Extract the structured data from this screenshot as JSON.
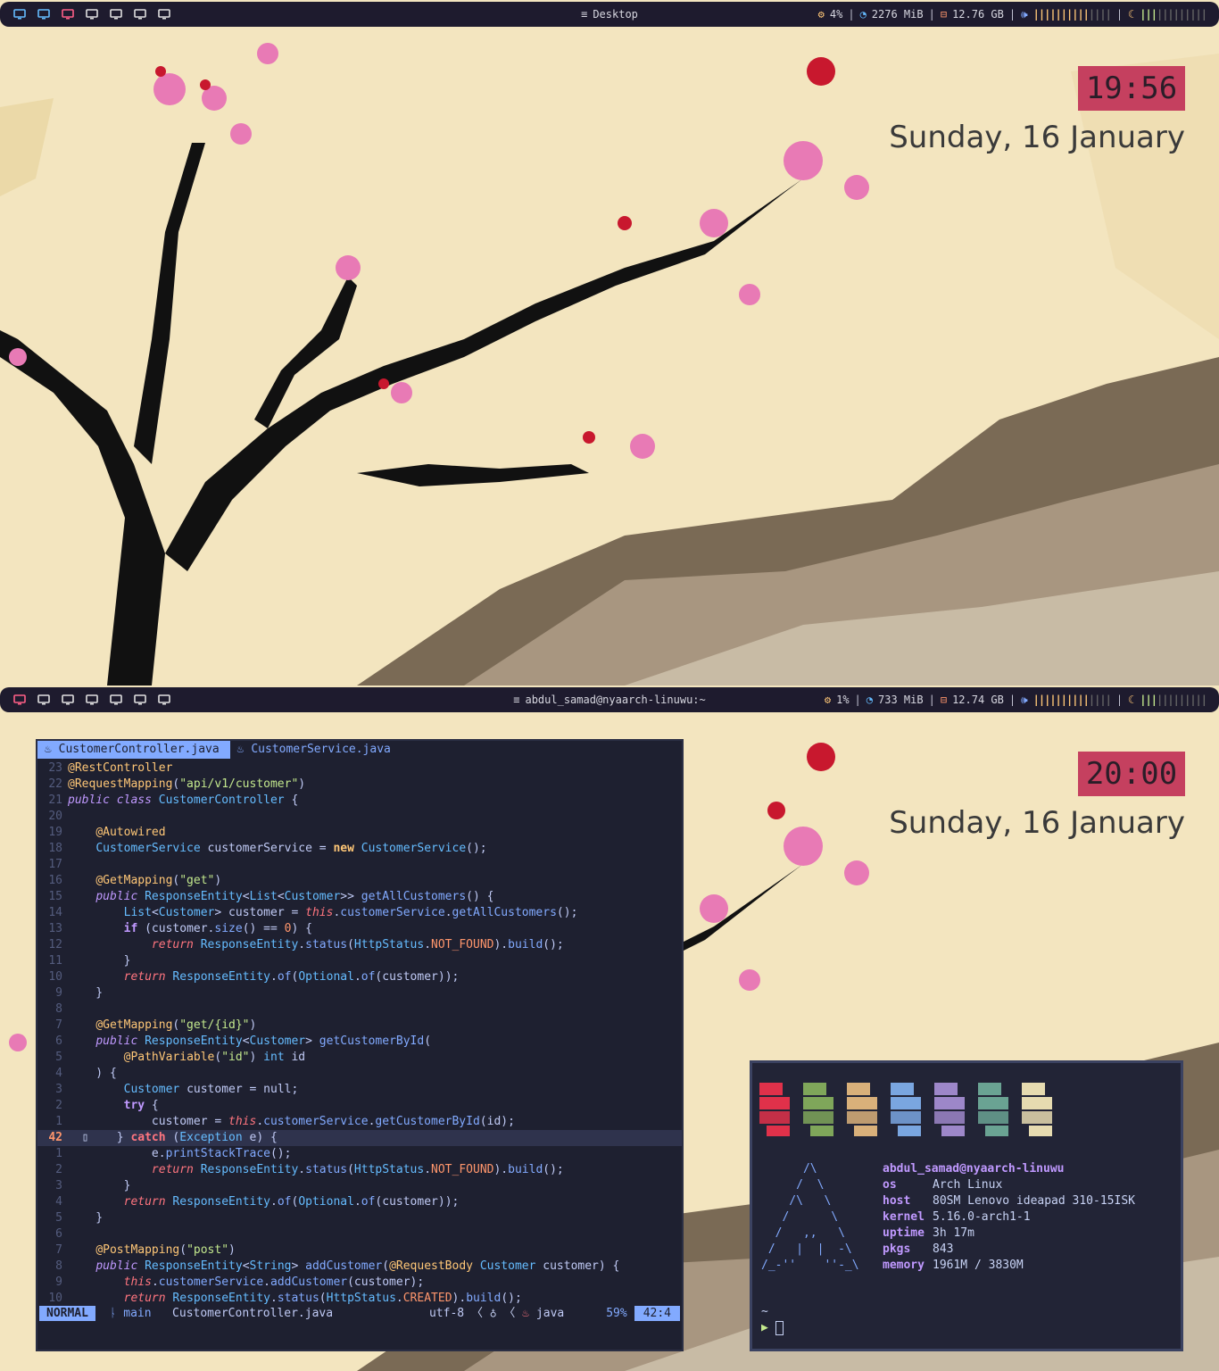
{
  "colors": {
    "accent_pink": "#c5405f",
    "bar_bg": "#1e1b2e",
    "editor_accent": "#82aaff"
  },
  "top": {
    "bar": {
      "window_title": "Desktop",
      "cpu": "4%",
      "memory": "2276 MiB",
      "disk": "12.76 GB",
      "separator": "|",
      "volume_meter": "||||||||||||",
      "brightness_meter": "||||||||||||",
      "workspace_icons": [
        "monitor-icon",
        "monitor-icon",
        "monitor-icon",
        "monitor-icon",
        "monitor-icon",
        "monitor-icon",
        "monitor-icon"
      ]
    },
    "clock": "19:56",
    "date": "Sunday, 16 January"
  },
  "bottom": {
    "bar": {
      "window_title": "abdul_samad@nyaarch-linuwu:~",
      "cpu": "1%",
      "memory": "733 MiB",
      "disk": "12.74 GB",
      "separator": "|",
      "volume_meter": "||||||||||||",
      "brightness_meter": "||||||||||||"
    },
    "clock": "20:00",
    "date": "Sunday, 16 January"
  },
  "editor": {
    "tabs": [
      "CustomerController.java",
      "CustomerService.java"
    ],
    "statusline": {
      "mode": "NORMAL",
      "branch": "main",
      "file": "CustomerController.java",
      "encoding": "utf-8",
      "filetype": "java",
      "percent": "59%",
      "position": "42:4"
    },
    "line_numbers": [
      "23",
      "22",
      "21",
      "20",
      "19",
      "18",
      "17",
      "16",
      "15",
      "14",
      "13",
      "12",
      "11",
      "10",
      "9",
      "8",
      "7",
      "6",
      "5",
      "4",
      "3",
      "2",
      "1",
      "42",
      "1",
      "2",
      "3",
      "4",
      "5",
      "6",
      "7",
      "8",
      "9",
      "10"
    ]
  },
  "terminal": {
    "user_host": "abdul_samad@nyaarch-linuwu",
    "info": [
      {
        "key": "os",
        "value": "Arch Linux"
      },
      {
        "key": "host",
        "value": "80SM Lenovo ideapad 310-15ISK"
      },
      {
        "key": "kernel",
        "value": "5.16.0-arch1-1"
      },
      {
        "key": "uptime",
        "value": "3h 17m"
      },
      {
        "key": "pkgs",
        "value": "843"
      },
      {
        "key": "memory",
        "value": "1961M / 3830M"
      }
    ],
    "block_colors": [
      "#e0314a",
      "#7fa65a",
      "#d9b07a",
      "#7aa6e0",
      "#9d87c9",
      "#6aa393",
      "#e6dbb0"
    ],
    "prompt_tilde": "~",
    "prompt_arrow": "▶"
  }
}
